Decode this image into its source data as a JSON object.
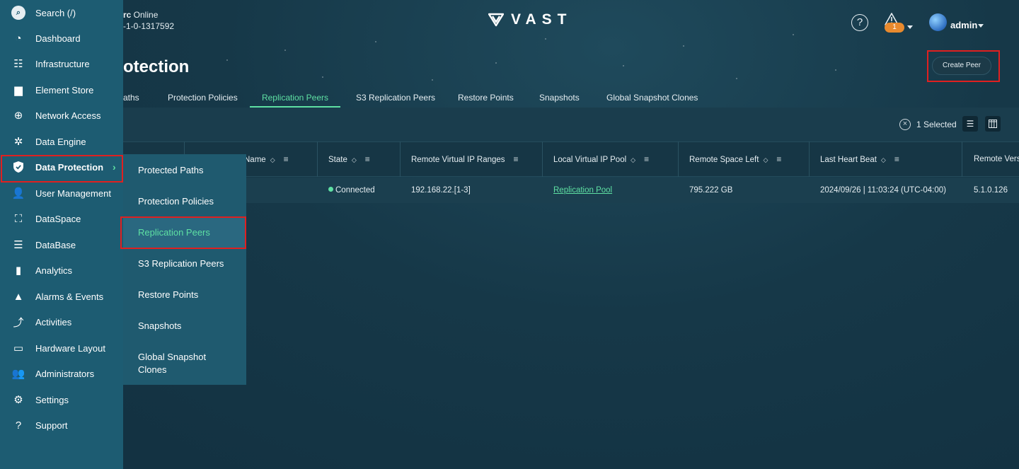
{
  "header": {
    "cluster_status_bold": "rc",
    "cluster_status_text": " Online",
    "cluster_version": "-1-0-1317592",
    "logo_text": "VAST",
    "help_label": "?",
    "alert_count": "1",
    "user_name": "admin"
  },
  "page": {
    "title": "otection",
    "create_button": "Create Peer"
  },
  "tabs": [
    {
      "label": "aths"
    },
    {
      "label": "Protection Policies"
    },
    {
      "label": "Replication Peers",
      "active": true
    },
    {
      "label": "S3 Replication Peers"
    },
    {
      "label": "Restore Points"
    },
    {
      "label": "Snapshots"
    },
    {
      "label": "Global Snapshot Clones"
    }
  ],
  "toolbar": {
    "selected_text": "1 Selected"
  },
  "table": {
    "columns": [
      {
        "label": "Name"
      },
      {
        "label": "State"
      },
      {
        "label": "Remote Virtual IP Ranges"
      },
      {
        "label": "Local Virtual IP Pool"
      },
      {
        "label": "Remote Space Left"
      },
      {
        "label": "Last Heart Beat"
      },
      {
        "label": "Remote Vers"
      }
    ],
    "rows": [
      {
        "state": "Connected",
        "remote_vip_ranges": "192.168.22.[1-3]",
        "local_vip_pool": "Replication Pool",
        "remote_space_left": "795.222 GB",
        "last_heart_beat": "2024/09/26 | 11:03:24 (UTC-04:00)",
        "remote_version": "5.1.0.126"
      }
    ]
  },
  "sidebar": {
    "items": [
      {
        "label": "Search (/)",
        "icon": "search-icon"
      },
      {
        "label": "Dashboard",
        "icon": "dashboard-icon"
      },
      {
        "label": "Infrastructure",
        "icon": "infrastructure-icon"
      },
      {
        "label": "Element Store",
        "icon": "folder-icon"
      },
      {
        "label": "Network Access",
        "icon": "globe-icon"
      },
      {
        "label": "Data Engine",
        "icon": "data-engine-icon"
      },
      {
        "label": "Data Protection",
        "icon": "shield-icon",
        "active": true
      },
      {
        "label": "User Management",
        "icon": "user-management-icon"
      },
      {
        "label": "DataSpace",
        "icon": "dataspace-icon"
      },
      {
        "label": "DataBase",
        "icon": "database-icon"
      },
      {
        "label": "Analytics",
        "icon": "analytics-icon"
      },
      {
        "label": "Alarms & Events",
        "icon": "warning-icon"
      },
      {
        "label": "Activities",
        "icon": "activities-icon"
      },
      {
        "label": "Hardware Layout",
        "icon": "hardware-icon"
      },
      {
        "label": "Administrators",
        "icon": "admin-icon"
      },
      {
        "label": "Settings",
        "icon": "gear-icon"
      },
      {
        "label": "Support",
        "icon": "question-icon"
      }
    ]
  },
  "submenu": {
    "items": [
      {
        "label": "Protected Paths"
      },
      {
        "label": "Protection Policies"
      },
      {
        "label": "Replication Peers",
        "active": true
      },
      {
        "label": "S3 Replication Peers"
      },
      {
        "label": "Restore Points"
      },
      {
        "label": "Snapshots"
      },
      {
        "label": "Global Snapshot Clones"
      }
    ]
  },
  "colors": {
    "accent": "#5ee0a3",
    "sidebar": "#1d5c72",
    "highlight": "#e02020",
    "badge": "#e88a2e"
  }
}
